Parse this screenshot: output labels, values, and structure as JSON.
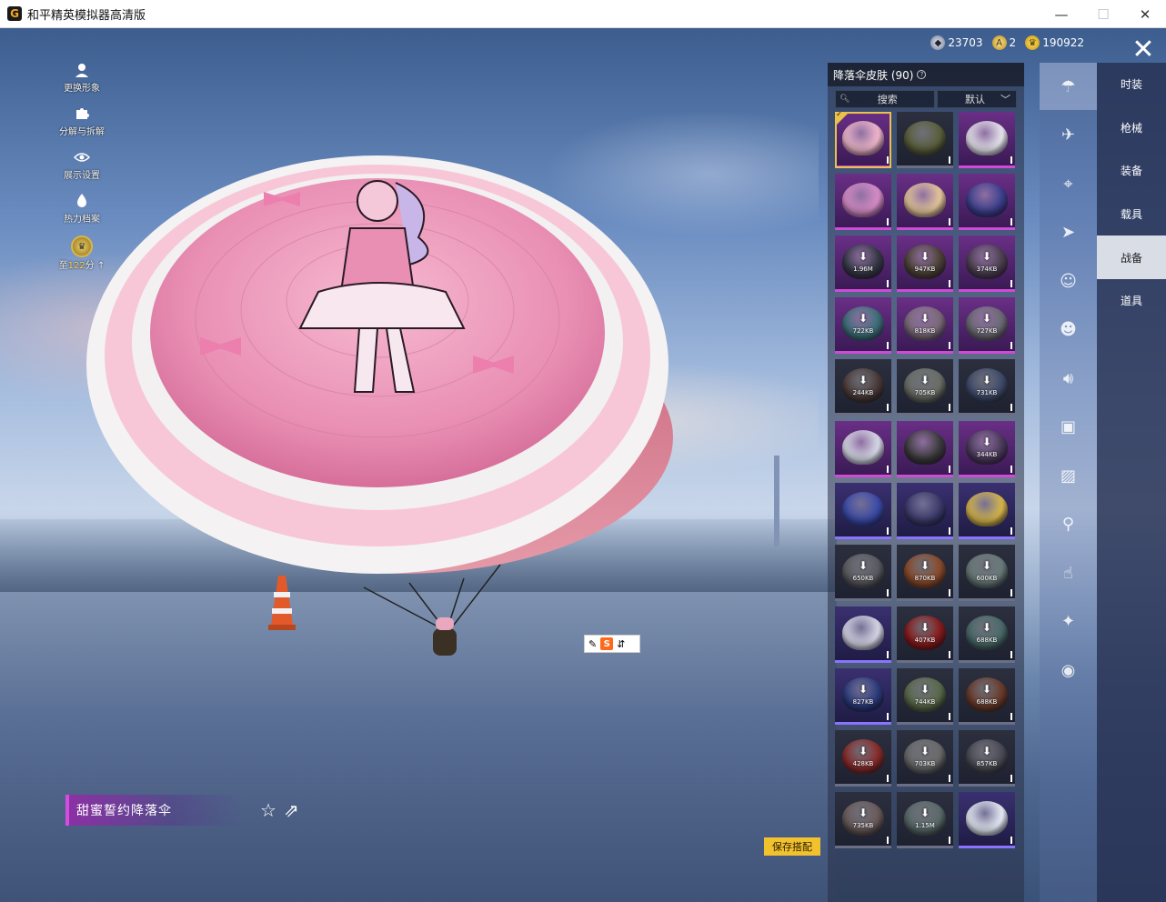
{
  "window": {
    "title": "和平精英模拟器高清版",
    "app_icon": "G",
    "controls": {
      "minimize": "—",
      "maximize": "☐",
      "close": "✕"
    }
  },
  "side_menu": {
    "items": [
      {
        "label": "更换形象",
        "icon": "person-icon"
      },
      {
        "label": "分解与拆解",
        "icon": "puzzle-icon"
      },
      {
        "label": "展示设置",
        "icon": "eye-icon"
      },
      {
        "label": "热力档案",
        "icon": "flame-icon"
      }
    ],
    "rank": {
      "prefix": "至",
      "value": "122",
      "suffix": "分"
    }
  },
  "currency": {
    "silver": "23703",
    "gold": "2",
    "crown": "190922"
  },
  "inventory": {
    "title": "降落伞皮肤 (90)",
    "search_placeholder": "搜索",
    "sort_label": "默认",
    "slots": [
      {
        "rarity": "legend",
        "color": "#f2b9cc",
        "size": "",
        "download": false,
        "selected": true
      },
      {
        "rarity": "normal",
        "color": "#5a5f3a",
        "size": "",
        "download": false
      },
      {
        "rarity": "legend",
        "color": "#e8e8ef",
        "size": "",
        "download": false
      },
      {
        "rarity": "legend",
        "color": "#d88ec8",
        "size": "",
        "download": false
      },
      {
        "rarity": "legend",
        "color": "#e6c89a",
        "size": "",
        "download": false
      },
      {
        "rarity": "legend",
        "color": "#3b3f8e",
        "size": "",
        "download": false
      },
      {
        "rarity": "legend",
        "color": "#333843",
        "size": "1.96M",
        "download": true
      },
      {
        "rarity": "legend",
        "color": "#4b4233",
        "size": "947KB",
        "download": true
      },
      {
        "rarity": "legend",
        "color": "#4b3f4f",
        "size": "374KB",
        "download": true
      },
      {
        "rarity": "legend",
        "color": "#3a6f78",
        "size": "722KB",
        "download": true
      },
      {
        "rarity": "legend",
        "color": "#7a6a78",
        "size": "818KB",
        "download": true
      },
      {
        "rarity": "legend",
        "color": "#6a6a72",
        "size": "727KB",
        "download": true
      },
      {
        "rarity": "normal",
        "color": "#4a3a38",
        "size": "244KB",
        "download": true
      },
      {
        "rarity": "normal",
        "color": "#6a6e66",
        "size": "705KB",
        "download": true
      },
      {
        "rarity": "normal",
        "color": "#3e4a6a",
        "size": "731KB",
        "download": true
      },
      {
        "rarity": "legend",
        "color": "#d8dce8",
        "size": "",
        "download": false
      },
      {
        "rarity": "legend",
        "color": "#3a3a3a",
        "size": "",
        "download": false
      },
      {
        "rarity": "legend",
        "color": "#4a3a5a",
        "size": "344KB",
        "download": true
      },
      {
        "rarity": "epic",
        "color": "#3a4aa8",
        "size": "",
        "download": false
      },
      {
        "rarity": "epic",
        "color": "#3a3a6a",
        "size": "",
        "download": false
      },
      {
        "rarity": "epic",
        "color": "#d8b84a",
        "size": "",
        "download": false
      },
      {
        "rarity": "normal",
        "color": "#5a5a60",
        "size": "650KB",
        "download": true
      },
      {
        "rarity": "normal",
        "color": "#8a4a2a",
        "size": "870KB",
        "download": true
      },
      {
        "rarity": "normal",
        "color": "#6a7a7a",
        "size": "600KB",
        "download": true
      },
      {
        "rarity": "epic",
        "color": "#d8d8e8",
        "size": "",
        "download": false
      },
      {
        "rarity": "normal",
        "color": "#8a1a1a",
        "size": "407KB",
        "download": true
      },
      {
        "rarity": "normal",
        "color": "#4a6a6a",
        "size": "688KB",
        "download": true
      },
      {
        "rarity": "epic",
        "color": "#2a3a7a",
        "size": "827KB",
        "download": true
      },
      {
        "rarity": "normal",
        "color": "#5a6a4a",
        "size": "744KB",
        "download": true
      },
      {
        "rarity": "normal",
        "color": "#6a3a2a",
        "size": "688KB",
        "download": true
      },
      {
        "rarity": "normal",
        "color": "#8a2a2a",
        "size": "428KB",
        "download": true
      },
      {
        "rarity": "normal",
        "color": "#6a6a6a",
        "size": "703KB",
        "download": true
      },
      {
        "rarity": "normal",
        "color": "#4a4a55",
        "size": "857KB",
        "download": true
      },
      {
        "rarity": "normal",
        "color": "#6a5a5a",
        "size": "735KB",
        "download": true
      },
      {
        "rarity": "normal",
        "color": "#5a6a6a",
        "size": "1.15M",
        "download": true
      },
      {
        "rarity": "epic",
        "color": "#e8eef8",
        "size": "",
        "download": false
      }
    ]
  },
  "category_icons": [
    "parachute-icon",
    "plane-icon",
    "drone-icon",
    "glider-icon",
    "face-icon",
    "robot-icon",
    "speaker-icon",
    "chat-icon",
    "image-icon",
    "extinguisher-icon",
    "hand-icon",
    "sparkle-icon",
    "ufo-icon"
  ],
  "tabs": [
    {
      "label": "时装",
      "active": false
    },
    {
      "label": "枪械",
      "active": false
    },
    {
      "label": "装备",
      "active": false
    },
    {
      "label": "载具",
      "active": false
    },
    {
      "label": "战备",
      "active": true
    },
    {
      "label": "道具",
      "active": false
    }
  ],
  "item_name": "甜蜜誓约降落伞",
  "save_button": "保存搭配",
  "ime": {
    "badge": "S"
  }
}
